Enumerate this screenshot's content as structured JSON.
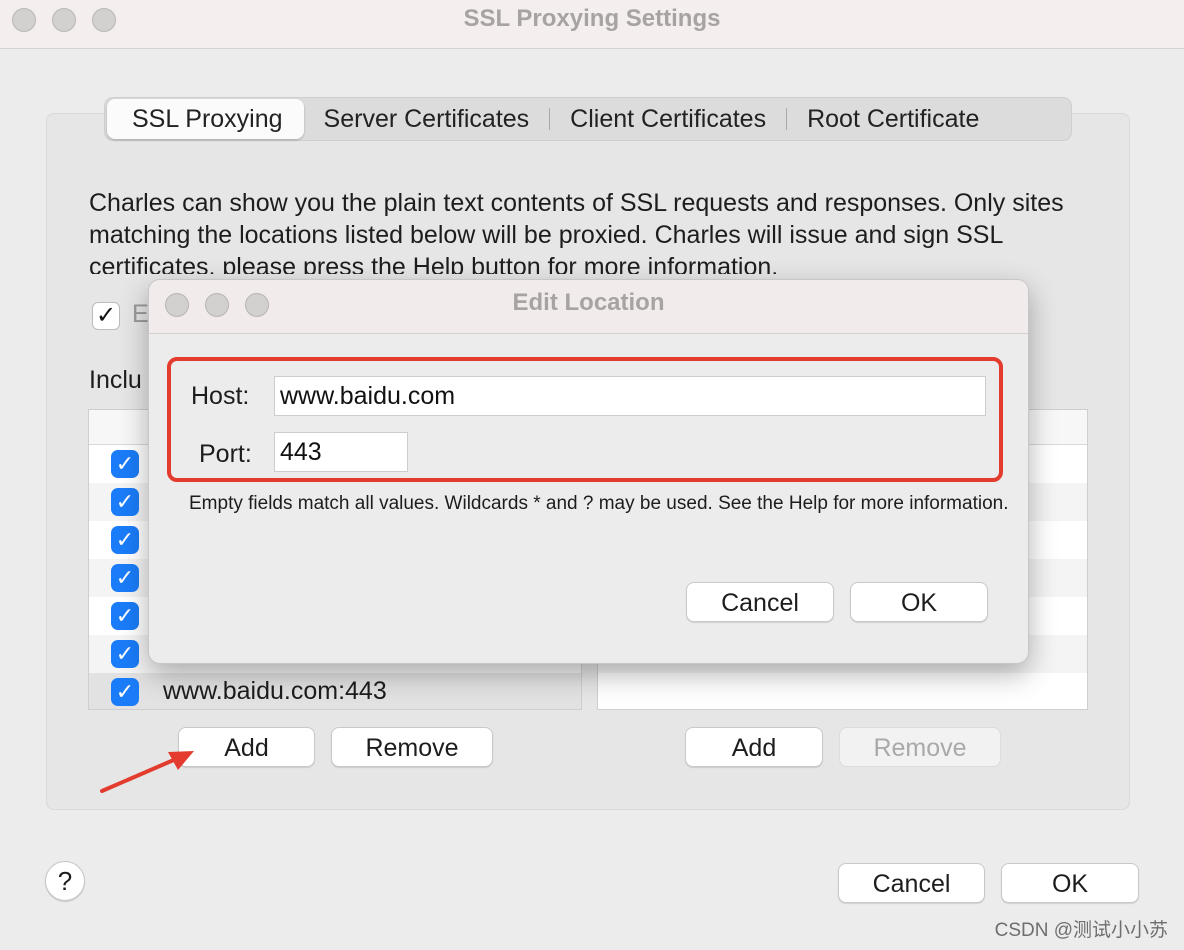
{
  "window": {
    "title": "SSL Proxying Settings"
  },
  "tabs": [
    {
      "label": "SSL Proxying",
      "active": true
    },
    {
      "label": "Server Certificates",
      "active": false
    },
    {
      "label": "Client Certificates",
      "active": false
    },
    {
      "label": "Root Certificate",
      "active": false
    }
  ],
  "description": "Charles can show you the plain text contents of SSL requests and responses. Only sites matching the locations listed below will be proxied. Charles will issue and sign SSL certificates, please press the Help button for more information.",
  "enable_checkbox": {
    "checked": true,
    "label_visible": "E"
  },
  "include_label_visible": "Inclu",
  "include_table": {
    "rows": [
      {
        "checked": true,
        "text": ""
      },
      {
        "checked": true,
        "text": ""
      },
      {
        "checked": true,
        "text": ""
      },
      {
        "checked": true,
        "text": ""
      },
      {
        "checked": true,
        "text": ""
      },
      {
        "checked": true,
        "text": ""
      },
      {
        "checked": true,
        "text": "www.baidu.com:443"
      }
    ],
    "add_label": "Add",
    "remove_label": "Remove"
  },
  "exclude_table": {
    "add_label": "Add",
    "remove_label": "Remove",
    "remove_disabled": true
  },
  "footer": {
    "help_label": "?",
    "cancel_label": "Cancel",
    "ok_label": "OK"
  },
  "dialog": {
    "title": "Edit Location",
    "host_label": "Host:",
    "host_value": "www.baidu.com",
    "port_label": "Port:",
    "port_value": "443",
    "hint": "Empty fields match all values. Wildcards * and ? may be used. See the Help for more information.",
    "cancel_label": "Cancel",
    "ok_label": "OK"
  },
  "icons": {
    "checkmark": "check-icon",
    "annotation": "red-arrow-icon"
  },
  "colors": {
    "accent": "#1a7cf8",
    "highlight": "#e33b2e"
  },
  "watermark": "CSDN @测试小小苏"
}
